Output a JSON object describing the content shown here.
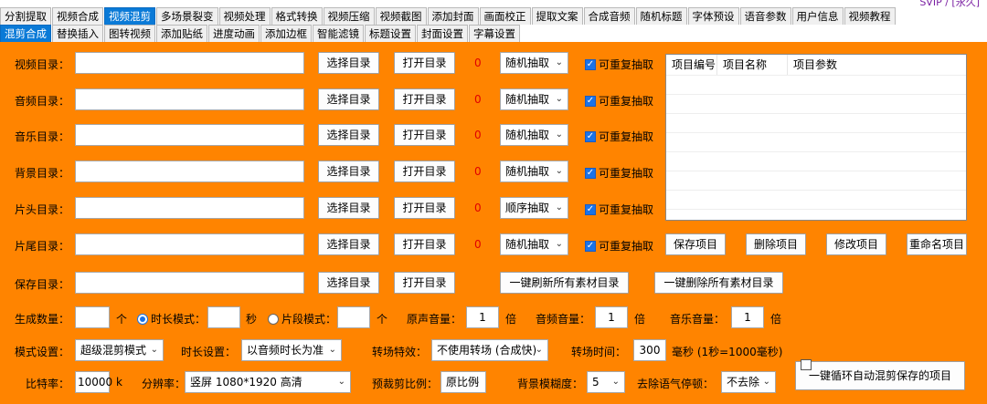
{
  "top_tabs": [
    "分割提取",
    "视频合成",
    "视频混剪",
    "多场景裂变",
    "视频处理",
    "格式转换",
    "视频压缩",
    "视频截图",
    "添加封面",
    "画面校正",
    "提取文案",
    "合成音频",
    "随机标题",
    "字体预设",
    "语音参数",
    "用户信息",
    "视频教程"
  ],
  "top_tabs_selected": "视频混剪",
  "sub_tabs": [
    "混剪合成",
    "替换插入",
    "图转视频",
    "添加贴纸",
    "进度动画",
    "添加边框",
    "智能滤镜",
    "标题设置",
    "封面设置",
    "字幕设置"
  ],
  "sub_tabs_selected": "混剪合成",
  "rows": [
    {
      "label": "视频目录：",
      "count": "0",
      "mode": "随机抽取",
      "repeat": "可重复抽取"
    },
    {
      "label": "音频目录：",
      "count": "0",
      "mode": "随机抽取",
      "repeat": "可重复抽取"
    },
    {
      "label": "音乐目录：",
      "count": "0",
      "mode": "随机抽取",
      "repeat": "可重复抽取"
    },
    {
      "label": "背景目录：",
      "count": "0",
      "mode": "随机抽取",
      "repeat": "可重复抽取"
    },
    {
      "label": "片头目录：",
      "count": "0",
      "mode": "顺序抽取",
      "repeat": "可重复抽取"
    },
    {
      "label": "片尾目录：",
      "count": "0",
      "mode": "随机抽取",
      "repeat": "可重复抽取"
    }
  ],
  "save_dir_label": "保存目录：",
  "choose_dir": "选择目录",
  "open_dir": "打开目录",
  "list_headers": [
    "项目编号",
    "项目名称",
    "项目参数"
  ],
  "project_buttons": [
    "保存项目",
    "删除项目",
    "修改项目",
    "重命名项目"
  ],
  "refresh_all": "一键刷新所有素材目录",
  "delete_all": "一键删除所有素材目录",
  "gen": {
    "count_label": "生成数量：",
    "count_unit": "个",
    "duration_mode": "时长模式：",
    "sec_unit": "秒",
    "segment_mode": "片段模式：",
    "segment_unit": "个",
    "orig_vol_label": "原声音量：",
    "orig_vol": "1",
    "times": "倍",
    "audio_vol_label": "音频音量：",
    "audio_vol": "1",
    "music_vol_label": "音乐音量：",
    "music_vol": "1"
  },
  "mode": {
    "label": "模式设置：",
    "value": "超级混剪模式",
    "dur_label": "时长设置：",
    "dur_value": "以音频时长为准",
    "trans_label": "转场特效：",
    "trans_value": "不使用转场 (合成快)",
    "trans_time_label": "转场时间：",
    "trans_time": "300",
    "trans_unit": "毫秒 (1秒=1000毫秒)"
  },
  "bitrate": {
    "label": "比特率：",
    "value": "10000",
    "unit": "k",
    "res_label": "分辨率：",
    "res_value": "竖屏  1080*1920   高清",
    "crop_label": "预裁剪比例：",
    "crop_value": "原比例",
    "blur_label": "背景模糊度：",
    "blur_value": "5",
    "pause_label": "去除语气停顿：",
    "pause_value": "不去除"
  },
  "loop_button": "一键循环自动混剪保存的项目",
  "top_right_text": "SVIP / [永久]"
}
